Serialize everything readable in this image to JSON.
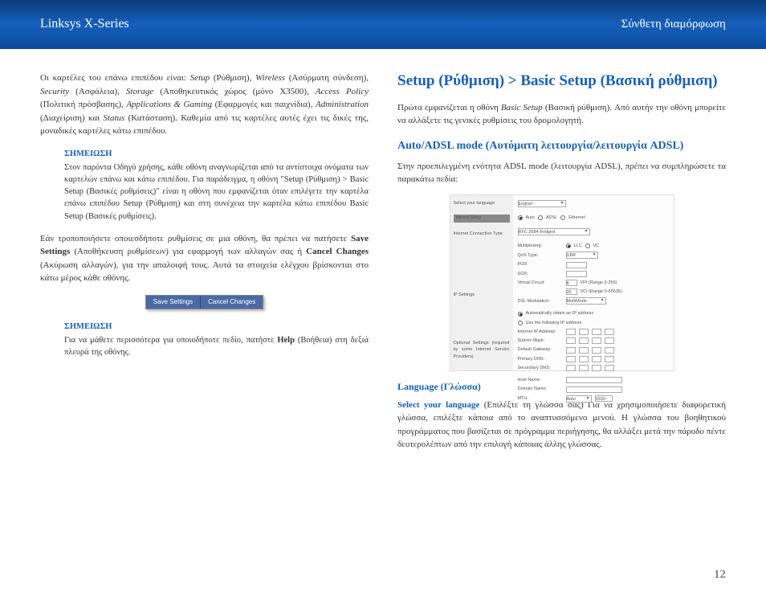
{
  "header": {
    "left": "Linksys X-Series",
    "right": "Σύνθετη διαμόρφωση"
  },
  "left_col": {
    "p1_parts": [
      "Οι καρτέλες του επάνω επιπέδου είναι: ",
      "Setup",
      " (Ρύθμιση), ",
      "Wireless",
      " (Ασύρματη σύνδεση), ",
      "Security",
      " (Ασφάλεια), ",
      "Storage",
      " (Αποθηκευτικός χώρος (μόνο X3500), ",
      "Access Policy",
      " (Πολιτική πρόσβασης), ",
      "Applications & Gaming",
      " (Εφαρμογές και παιχνίδια), ",
      "Administration",
      " (Διαχείριση) και ",
      "Status",
      " (Κατάσταση). Καθεμία από τις καρτέλες αυτές έχει τις δικές της, μοναδικές καρτέλες κάτω επιπέδου."
    ],
    "note1_title": "ΣΗΜΕΙΩΣΗ",
    "note1_body": "Στον παρόντα Οδηγό χρήσης, κάθε οθόνη αναγνωρίζεται από τα αντίστοιχα ονόματα των καρτελών επάνω και κάτω επιπέδου. Για παράδειγμα, η οθόνη \"Setup (Ρύθμιση) > Basic Setup (Βασικές ρυθμίσεις)\" είναι η οθόνη που εμφανίζεται όταν επιλέγετε την καρτέλα επάνω επιπέδου Setup (Ρύθμιση) και στη συνέχεια την καρτέλα κάτω επιπέδου Basic Setup (Βασικές ρυθμίσεις).",
    "p2_prefix": "Εάν τροποποιήσετε οποιεσδήποτε ρυθμίσεις σε μια οθόνη, θα πρέπει να πατήσετε ",
    "p2_b1": "Save Settings",
    "p2_mid1": " (Αποθήκευση ρυθμίσεων) για εφαρμογή των αλλαγών σας ή ",
    "p2_b2": "Cancel Changes",
    "p2_suffix": " (Ακύρωση αλλαγών), για την απαλοιφή τους. Αυτά τα στοιχεία ελέγχου βρίσκονται στο κάτω μέρος κάθε οθόνης.",
    "btn_save": "Save Settings",
    "btn_cancel": "Cancel Changes",
    "note2_title": "ΣΗΜΕΙΩΣΗ",
    "note2_prefix": "Για να μάθετε περισσότερα για οποιοδήποτε πεδίο, πατήστε ",
    "note2_bold": "Help",
    "note2_suffix": " (Βοήθεια) στη δεξιά πλευρά της οθόνης."
  },
  "right_col": {
    "h1": "Setup (Ρύθμιση) > Basic Setup (Βασική ρύθμιση)",
    "p1_prefix": "Πρώτα εμφανίζεται η οθόνη ",
    "p1_ital": "Basic Setup",
    "p1_suffix": " (Βασική ρύθμιση). Από αυτήν την οθόνη μπορείτε να αλλάξετε τις γενικές ρυθμίσεις του δρομολογητή.",
    "h2": "Auto/ADSL mode (Αυτόματη λειτουργία/λειτουργία ADSL)",
    "p2": "Στην προεπιλεγμένη ενότητα ADSL mode (λειτουργία ADSL), πρέπει να συμπληρώσετε τα παρακάτω πεδία:",
    "shot": {
      "left_labels": [
        "Select your language",
        "Internet Setup",
        "Internet Connection Type",
        "",
        "IP Settings",
        "Optional Settings (required by some Internet Service Providers)"
      ],
      "row_lang_val": "English",
      "row_mode_opts": [
        "Auto",
        "ADSL",
        "Ethernet"
      ],
      "row_ict_val": "RFC 2684 Bridged",
      "rows_labels": [
        "Multiplexing:",
        "QoS Type:",
        "PCR:",
        "SCR:",
        "Virtual Circuit:",
        "DSL Modulation:"
      ],
      "multiplexing_opts": [
        "LLC",
        "VC"
      ],
      "qos_val": "UBR",
      "vc_vpi": "8",
      "vc_vpi_hint": "VPI (Range 0-255)",
      "vc_vci": "35",
      "vc_vci_hint": "VCI (Range 0-65535)",
      "dslmod_val": "MultiMode",
      "ip_opts": [
        "Automatically obtain an IP address",
        "Use the following IP address"
      ],
      "ip_rows": [
        "Internet IP Address:",
        "Subnet Mask:",
        "Default Gateway:",
        "Primary DNS:",
        "Secondary DNS:"
      ],
      "opt_rows": [
        "Host Name:",
        "Domain Name:",
        "MTU:"
      ],
      "mtu_val": "Auto",
      "mtu_size": "1500"
    },
    "h3": "Language (Γλώσσα)",
    "p3_bold": "Select your language",
    "p3_suffix": " (Επιλέξτε τη γλώσσα σας) Για να χρησιμοποιήσετε διαφορετική γλώσσα, επιλέξτε κάποια από το αναπτυσσόμενο μενού. Η γλώσσα του βοηθητικού προγράμματος που βασίζεται σε πρόγραμμα περιήγησης, θα αλλάξει μετά την πάροδο πέντε δευτερολέπτων από την επιλογή κάποιας άλλης γλώσσας."
  },
  "page_number": "12"
}
